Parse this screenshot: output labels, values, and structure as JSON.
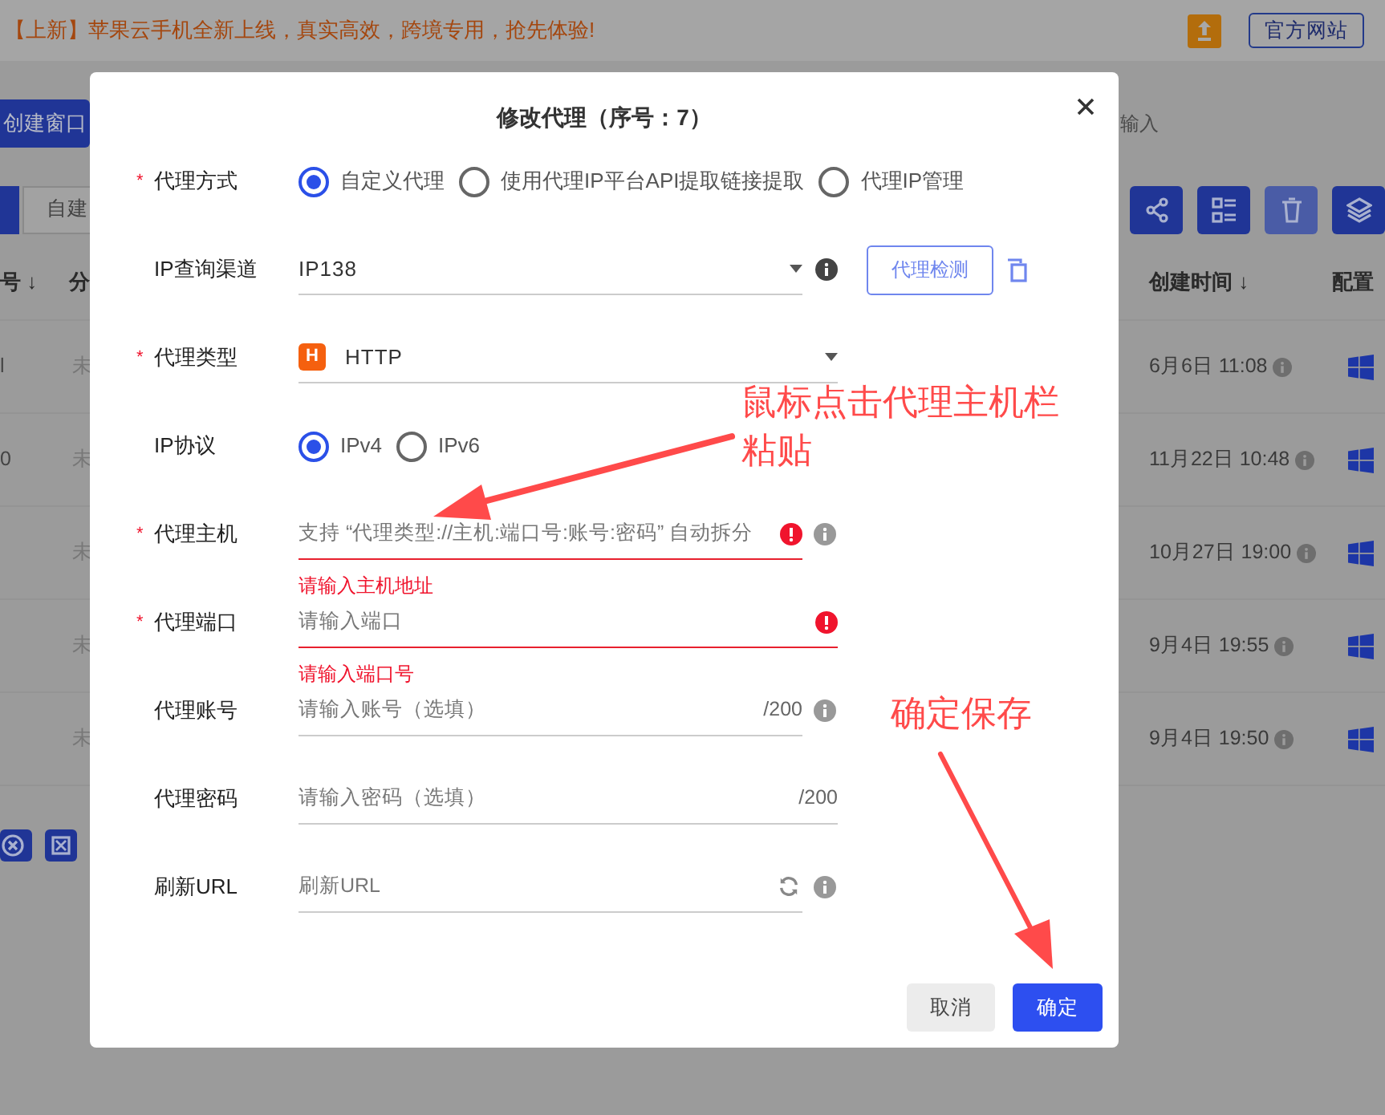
{
  "top_bar": {
    "announcement": "【上新】苹果云手机全新上线，真实高效，跨境专用，抢先体验!",
    "website_button": "官方网站"
  },
  "toolbar": {
    "create_button": "创建窗口",
    "search_placeholder": "输入",
    "filter_tab": "自建"
  },
  "table": {
    "columns": [
      "号 ↓",
      "分",
      "创建时间 ↓",
      "配置"
    ],
    "rows": [
      {
        "column_1": "l",
        "column_2": "未",
        "created": "6月6日 11:08"
      },
      {
        "column_1": "0",
        "column_2": "未",
        "created": "11月22日 10:48"
      },
      {
        "column_2": "未",
        "created": "10月27日 19:00"
      },
      {
        "column_2": "未",
        "created": "9月4日 19:55"
      },
      {
        "column_2": "未",
        "created": "9月4日 19:50"
      }
    ]
  },
  "dialog": {
    "title": "修改代理（序号：7）",
    "fields": [
      {
        "kind": "radio",
        "label": "代理方式",
        "required_mark": "*",
        "options": [
          {
            "label": "自定义代理",
            "selected": true
          },
          {
            "label": "使用代理IP平台API提取链接提取",
            "selected": false
          },
          {
            "label": "代理IP管理",
            "selected": false
          }
        ]
      },
      {
        "kind": "select",
        "label": "IP查询渠道",
        "value": "IP138",
        "info": true,
        "check_button": "代理检测"
      },
      {
        "kind": "select",
        "label": "代理类型",
        "required_mark": "*",
        "value": "HTTP",
        "badge": "H",
        "info": false
      },
      {
        "kind": "radio",
        "label": "IP协议",
        "options": [
          {
            "label": "IPv4",
            "selected": true
          },
          {
            "label": "IPv6",
            "selected": false
          }
        ]
      },
      {
        "kind": "input",
        "label": "代理主机",
        "required_mark": "*",
        "placeholder": "支持 “代理类型://主机:端口号:账号:密码” 自动拆分",
        "error": "请输入主机地址",
        "info": true
      },
      {
        "kind": "input",
        "label": "代理端口",
        "required_mark": "*",
        "placeholder": "请输入端口",
        "error": "请输入端口号",
        "info": false
      },
      {
        "kind": "input",
        "label": "代理账号",
        "placeholder": "请输入账号（选填）",
        "counter": "/200",
        "info": true
      },
      {
        "kind": "input",
        "label": "代理密码",
        "placeholder": "请输入密码（选填）",
        "counter": "/200",
        "info": false
      },
      {
        "kind": "input",
        "label": "刷新URL",
        "placeholder": "刷新URL",
        "refresh": true,
        "info": true
      }
    ],
    "buttons": [
      {
        "label": "取消",
        "kind": "secondary"
      },
      {
        "label": "确定",
        "kind": "primary"
      }
    ]
  },
  "annotations": [
    {
      "lines": [
        "鼠标点击代理主机栏",
        "粘贴"
      ]
    },
    {
      "lines": [
        "确定保存"
      ]
    }
  ]
}
